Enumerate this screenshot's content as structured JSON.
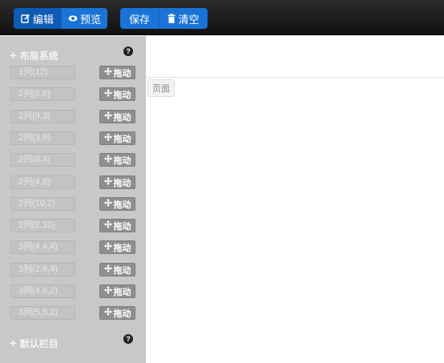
{
  "toolbar": {
    "edit_label": "编辑",
    "preview_label": "预览",
    "save_label": "保存",
    "clear_label": "清空"
  },
  "sidebar": {
    "layout_title": "布局系统",
    "default_title": "默认栏目",
    "help_glyph": "?",
    "plus_glyph": "+",
    "drag_label": "拖动",
    "rows": [
      {
        "label": "1列(12)"
      },
      {
        "label": "2列(6,6)"
      },
      {
        "label": "2列(9,3)"
      },
      {
        "label": "2列(3,9)"
      },
      {
        "label": "2列(8,4)"
      },
      {
        "label": "2列(4,8)"
      },
      {
        "label": "2列(10,2)"
      },
      {
        "label": "2列(2,10)"
      },
      {
        "label": "3列(4,4,4)"
      },
      {
        "label": "3列(2,6,4)"
      },
      {
        "label": "3列(4,6,2)"
      },
      {
        "label": "3列(5,5,2)"
      }
    ]
  },
  "canvas": {
    "page_label": "页面"
  },
  "colors": {
    "toolbar_bg": "#111111",
    "button_blue": "#1a73d6",
    "sidebar_bg": "#c8c8c8",
    "drag_bg": "#8f8f8f"
  }
}
